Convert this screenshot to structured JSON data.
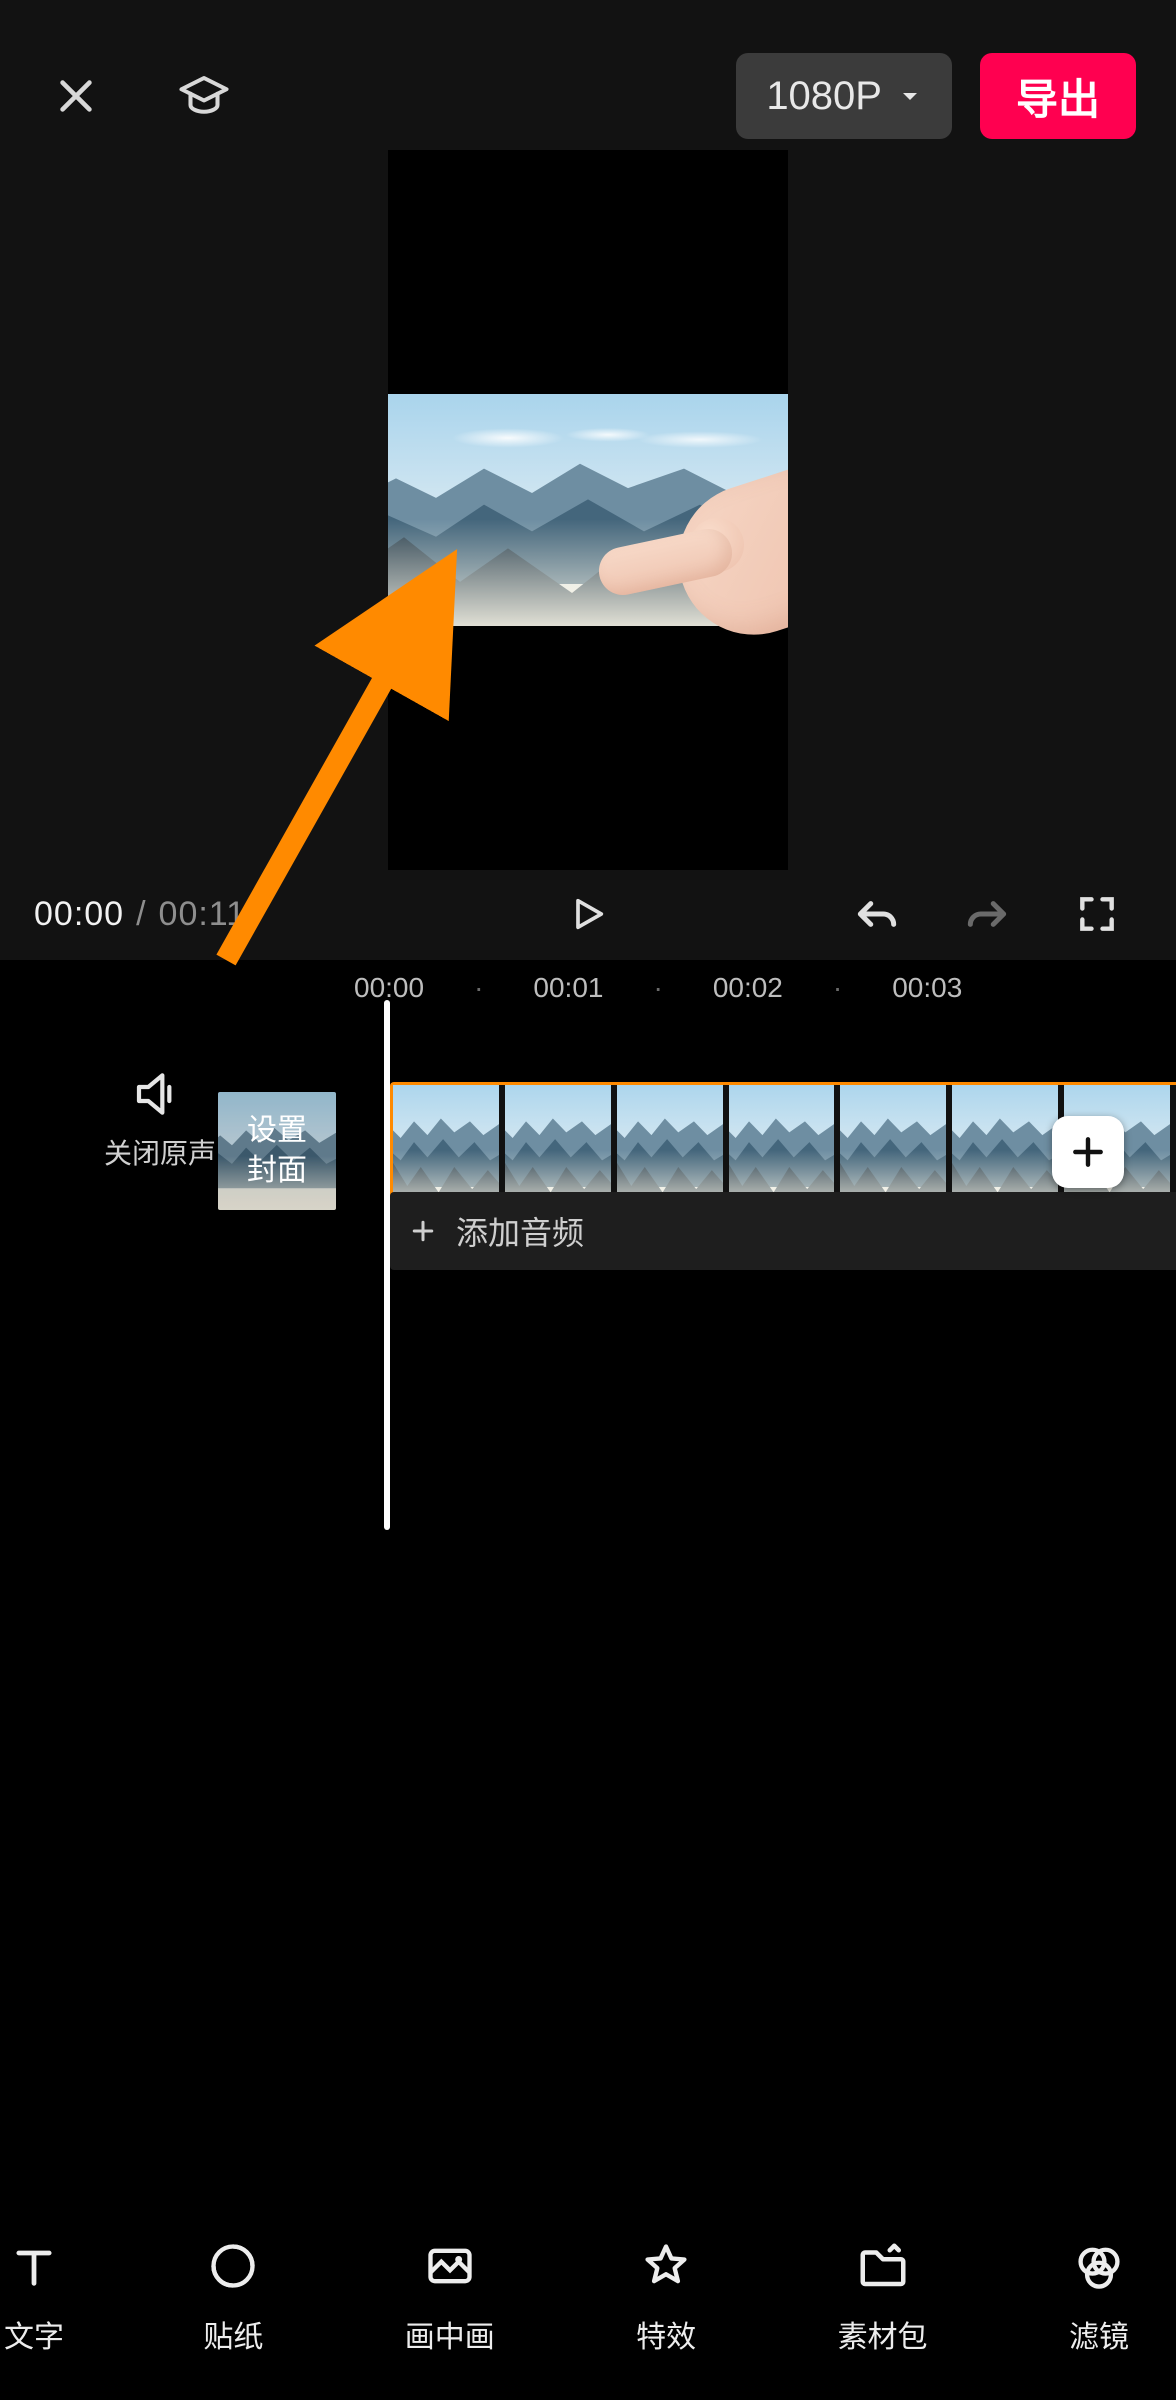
{
  "colors": {
    "accent_export": "#ff0050",
    "accent_timeline": "#ff8a00",
    "annotation_arrow": "#ff8a00"
  },
  "topbar": {
    "resolution_label": "1080P",
    "export_label": "导出"
  },
  "icons": {
    "close": "close-icon",
    "tutorial": "graduation-cap-icon",
    "chevron_down": "chevron-down-icon",
    "play": "play-icon",
    "undo": "undo-icon",
    "redo": "redo-icon",
    "fullscreen": "fullscreen-icon",
    "speaker": "speaker-icon",
    "plus": "plus-icon",
    "add_clip": "plus-icon"
  },
  "playback": {
    "current": "00:00",
    "separator": "/",
    "duration": "00:11"
  },
  "ruler": {
    "marks": [
      "00:00",
      "·",
      "00:01",
      "·",
      "00:02",
      "·",
      "00:03"
    ]
  },
  "mute": {
    "label": "关闭原声"
  },
  "cover": {
    "line1": "设置",
    "line2": "封面"
  },
  "audio": {
    "add_label": "添加音频"
  },
  "toolbar": {
    "items": [
      {
        "icon": "text-icon",
        "label": "文字"
      },
      {
        "icon": "sticker-icon",
        "label": "贴纸"
      },
      {
        "icon": "pip-icon",
        "label": "画中画"
      },
      {
        "icon": "effects-icon",
        "label": "特效"
      },
      {
        "icon": "assets-icon",
        "label": "素材包"
      },
      {
        "icon": "filter-icon",
        "label": "滤镜"
      }
    ]
  },
  "preview": {
    "content": "mountain-landscape-with-pointing-hand"
  }
}
